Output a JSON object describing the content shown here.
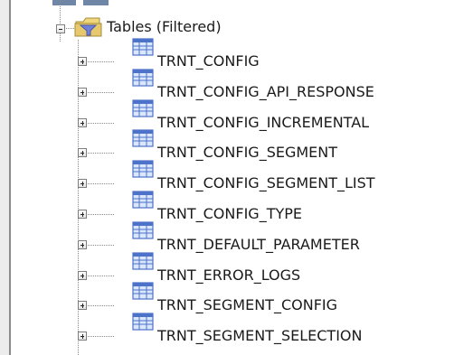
{
  "tree": {
    "folder": {
      "label": "Tables (Filtered)",
      "icon": "filtered-folder-icon",
      "expanded": true
    },
    "items": [
      {
        "label": "TRNT_CONFIG",
        "icon": "table-icon"
      },
      {
        "label": "TRNT_CONFIG_API_RESPONSE",
        "icon": "table-icon"
      },
      {
        "label": "TRNT_CONFIG_INCREMENTAL",
        "icon": "table-icon"
      },
      {
        "label": "TRNT_CONFIG_SEGMENT",
        "icon": "table-icon"
      },
      {
        "label": "TRNT_CONFIG_SEGMENT_LIST",
        "icon": "table-icon"
      },
      {
        "label": "TRNT_CONFIG_TYPE",
        "icon": "table-icon"
      },
      {
        "label": "TRNT_DEFAULT_PARAMETER",
        "icon": "table-icon"
      },
      {
        "label": "TRNT_ERROR_LOGS",
        "icon": "table-icon"
      },
      {
        "label": "TRNT_SEGMENT_CONFIG",
        "icon": "table-icon"
      },
      {
        "label": "TRNT_SEGMENT_SELECTION",
        "icon": "table-icon"
      }
    ]
  },
  "colors": {
    "table_icon_blue": "#4d72c9",
    "table_icon_light": "#dbe7ff",
    "folder_yellow": "#e5c76f",
    "folder_blue": "#7081d9"
  }
}
